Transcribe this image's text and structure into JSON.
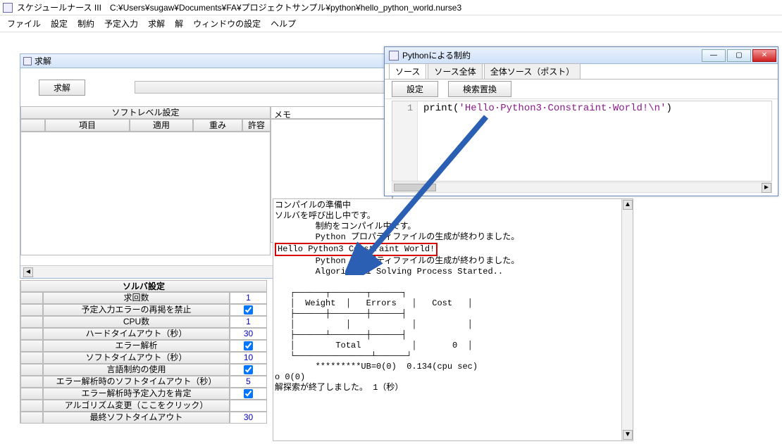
{
  "app": {
    "name": "スケジュールナース III",
    "path": "C:¥Users¥sugaw¥Documents¥FA¥プロジェクトサンプル¥python¥hello_python_world.nurse3"
  },
  "menu": [
    "ファイル",
    "設定",
    "制約",
    "予定入力",
    "求解",
    "解",
    "ウィンドウの設定",
    "ヘルプ"
  ],
  "solve_panel": {
    "title": "求解",
    "solve_button": "求解",
    "soft_level_title": "ソフトレベル設定",
    "cols": [
      "",
      "項目",
      "適用",
      "重み",
      "許容"
    ],
    "memo_label": "メモ"
  },
  "solver_table": {
    "title": "ソルバ設定",
    "rows": [
      {
        "name": "求回数",
        "val": "1",
        "type": "num"
      },
      {
        "name": "予定入力エラーの再掲を禁止",
        "val": "true",
        "type": "chk"
      },
      {
        "name": "CPU数",
        "val": "1",
        "type": "num"
      },
      {
        "name": "ハードタイムアウト（秒）",
        "val": "30",
        "type": "num"
      },
      {
        "name": "エラー解析",
        "val": "true",
        "type": "chk"
      },
      {
        "name": "ソフトタイムアウト（秒）",
        "val": "10",
        "type": "num"
      },
      {
        "name": "言語制約の使用",
        "val": "true",
        "type": "chk"
      },
      {
        "name": "エラー解析時のソフトタイムアウト（秒）",
        "val": "5",
        "type": "num"
      },
      {
        "name": "エラー解析時予定入力を肯定",
        "val": "true",
        "type": "chk"
      },
      {
        "name": "アルゴリズム変更（ここをクリック）",
        "val": "",
        "type": "txt"
      },
      {
        "name": "最終ソフトタイムアウト",
        "val": "30",
        "type": "num"
      }
    ]
  },
  "output": {
    "pre1": "コンパイルの準備中\nソルバを呼び出し中です。\n        制約をコンパイル中です。\n        Python プロパティファイルの生成が終わりました。",
    "highlight": "Hello Python3 Constraint World!",
    "pre2": "\n        Python プロパティファイルの生成が終わりました。\n        Algorithm 1 Solving Process Started..\n\n   ┌──────┬───────┬──────┐\n   │  Weight  │   Errors   │   Cost   │\n   ├──────┼───────┼──────┤\n   │          │            │          │\n   ├──────┴───────┼──────┤\n   │        Total          │       0  │\n   └───────────────┴──────┘\n        *********UB=0(0)  0.134(cpu sec)\no 0(0)\n解探索が終了しました。 1（秒）"
  },
  "python_window": {
    "title": "Pythonによる制約",
    "tabs": [
      "ソース",
      "ソース全体",
      "全体ソース（ポスト）"
    ],
    "active_tab": 0,
    "buttons": {
      "settings": "設定",
      "findrep": "検索置換"
    },
    "line_no": "1",
    "code_func": "print",
    "code_open": "(",
    "code_string": "'Hello·Python3·Constraint·World!\\n'",
    "code_close": ")"
  }
}
